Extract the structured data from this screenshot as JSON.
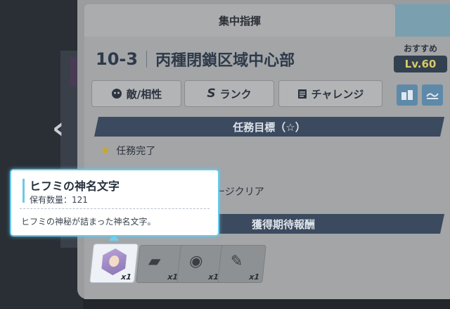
{
  "panel": {
    "header_title": "集中指揮",
    "stage_number": "10-3",
    "stage_name": "丙種閉鎖区域中心部",
    "recommend_label": "おすすめ",
    "recommend_level": "Lv.60"
  },
  "buttons": {
    "enemy": "敵/相性",
    "rank_prefix": "S",
    "rank": "ランク",
    "challenge": "チャレンジ"
  },
  "objectives": {
    "header": "任務目標（☆）",
    "items": [
      "任務完了",
      "ージクリア"
    ]
  },
  "rewards": {
    "header": "獲得期待報酬",
    "items": [
      {
        "icon": "sacred-name-gem",
        "count": "x1"
      },
      {
        "icon": "shoes-item",
        "count": "x1"
      },
      {
        "icon": "necklace-item",
        "count": "x1"
      },
      {
        "icon": "feather-item",
        "count": "x1"
      }
    ]
  },
  "tooltip": {
    "name": "ヒフミの神名文字",
    "quantity": "保有数量：121",
    "description": "ヒフミの神秘が詰まった神名文字。"
  },
  "nav": {
    "prev_glyph": "‹"
  },
  "colors": {
    "section_bar": "#3b4a5e",
    "tooltip_border": "#69c9ec",
    "recommend_level": "#d9c96a"
  }
}
